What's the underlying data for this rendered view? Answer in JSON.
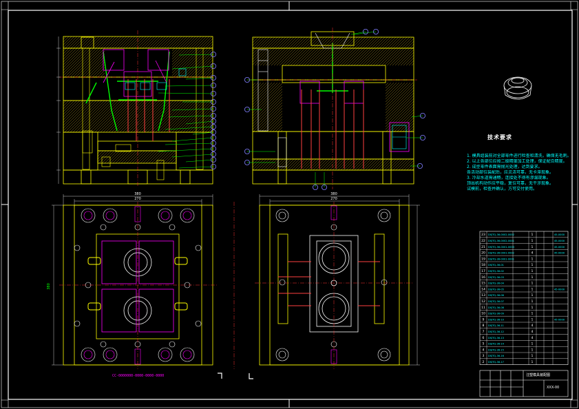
{
  "colors": {
    "background": "#000000",
    "frame": "#ffffff",
    "outline": "#ffff00",
    "hatch": "#e0c020",
    "center": "#ff3030",
    "pin": "#ff6060",
    "green": "#00ff00",
    "cyan": "#00ffff",
    "leader": "#00ff00",
    "balloon": "#8080ff",
    "magenta": "#ff00ff"
  },
  "notes": {
    "title": "技术要求",
    "lines": [
      "1. 模具组装前对全部零件进行检查和清洗，确保无毛刺。",
      "2. 以上各部位应按二级精度加工处理，保证配合精度。",
      "2. 成型零件表面需抛光处理，达到要求。",
      "各活动部位装配后，应灵活可靠，无卡滞现象。",
      "3. 冷却水道需通畅，连接处不得有渗漏现象。",
      "顶出机构动作应平稳，复位可靠，无干涉现象。",
      "试模前，检查并确认，方可交付使用。"
    ]
  },
  "caption": "CC-0000000-0000-0000-0000",
  "dimensions": {
    "left_width": "380",
    "left_inner": "270",
    "right_width": "380",
    "right_inner": "270",
    "left_height": "380"
  },
  "title_block": {
    "drawing_name": "注塑模具装配图",
    "drawing_code": "XXX-00"
  },
  "bom": {
    "row_count": 22,
    "rows": [
      {
        "no": "23",
        "code": "DSJTQ-36-0002-0002",
        "qty": "1",
        "note": "45-0000"
      },
      {
        "no": "22",
        "code": "DSJTQ-36-0002-0001",
        "qty": "1",
        "note": "45-0000"
      },
      {
        "no": "21",
        "code": "DSJTQ-36-0001-0003",
        "qty": "1",
        "note": "45-0000"
      },
      {
        "no": "20",
        "code": "DSJTQ-36-0001-0002",
        "qty": "4",
        "note": "45-0000"
      },
      {
        "no": "19",
        "code": "DSJTQ-36-0001-0001",
        "qty": "1",
        "note": ""
      },
      {
        "no": "18",
        "code": "DSJTQ-36-01",
        "qty": "1",
        "note": ""
      },
      {
        "no": "17",
        "code": "DSJTQ-36-02",
        "qty": "1",
        "note": ""
      },
      {
        "no": "16",
        "code": "DSJTQ-36-03",
        "qty": "1",
        "note": ""
      },
      {
        "no": "15",
        "code": "DSJTQ-36-04",
        "qty": "1",
        "note": ""
      },
      {
        "no": "14",
        "code": "DSJTQ-36-05",
        "qty": "1",
        "note": "45-0000"
      },
      {
        "no": "13",
        "code": "DSJTQ-36-06",
        "qty": "1",
        "note": ""
      },
      {
        "no": "12",
        "code": "DSJTQ-36-07",
        "qty": "1",
        "note": ""
      },
      {
        "no": "11",
        "code": "DSJTQ-36-08",
        "qty": "1",
        "note": ""
      },
      {
        "no": "10",
        "code": "DSJTQ-36-09",
        "qty": "1",
        "note": ""
      },
      {
        "no": "9",
        "code": "DSJTQ-36-10",
        "qty": "1",
        "note": "45-0000"
      },
      {
        "no": "8",
        "code": "DSJTQ-36-11",
        "qty": "4",
        "note": ""
      },
      {
        "no": "7",
        "code": "DSJTQ-36-12",
        "qty": "4",
        "note": ""
      },
      {
        "no": "6",
        "code": "DSJTQ-36-13",
        "qty": "4",
        "note": ""
      },
      {
        "no": "5",
        "code": "DSJTQ-36-14",
        "qty": "1",
        "note": ""
      },
      {
        "no": "4",
        "code": "DSJTQ-36-15",
        "qty": "1",
        "note": ""
      },
      {
        "no": "3",
        "code": "DSJTQ-36-16",
        "qty": "1",
        "note": ""
      },
      {
        "no": "2",
        "code": "DSJTQ-36-17",
        "qty": "1",
        "note": ""
      }
    ]
  }
}
